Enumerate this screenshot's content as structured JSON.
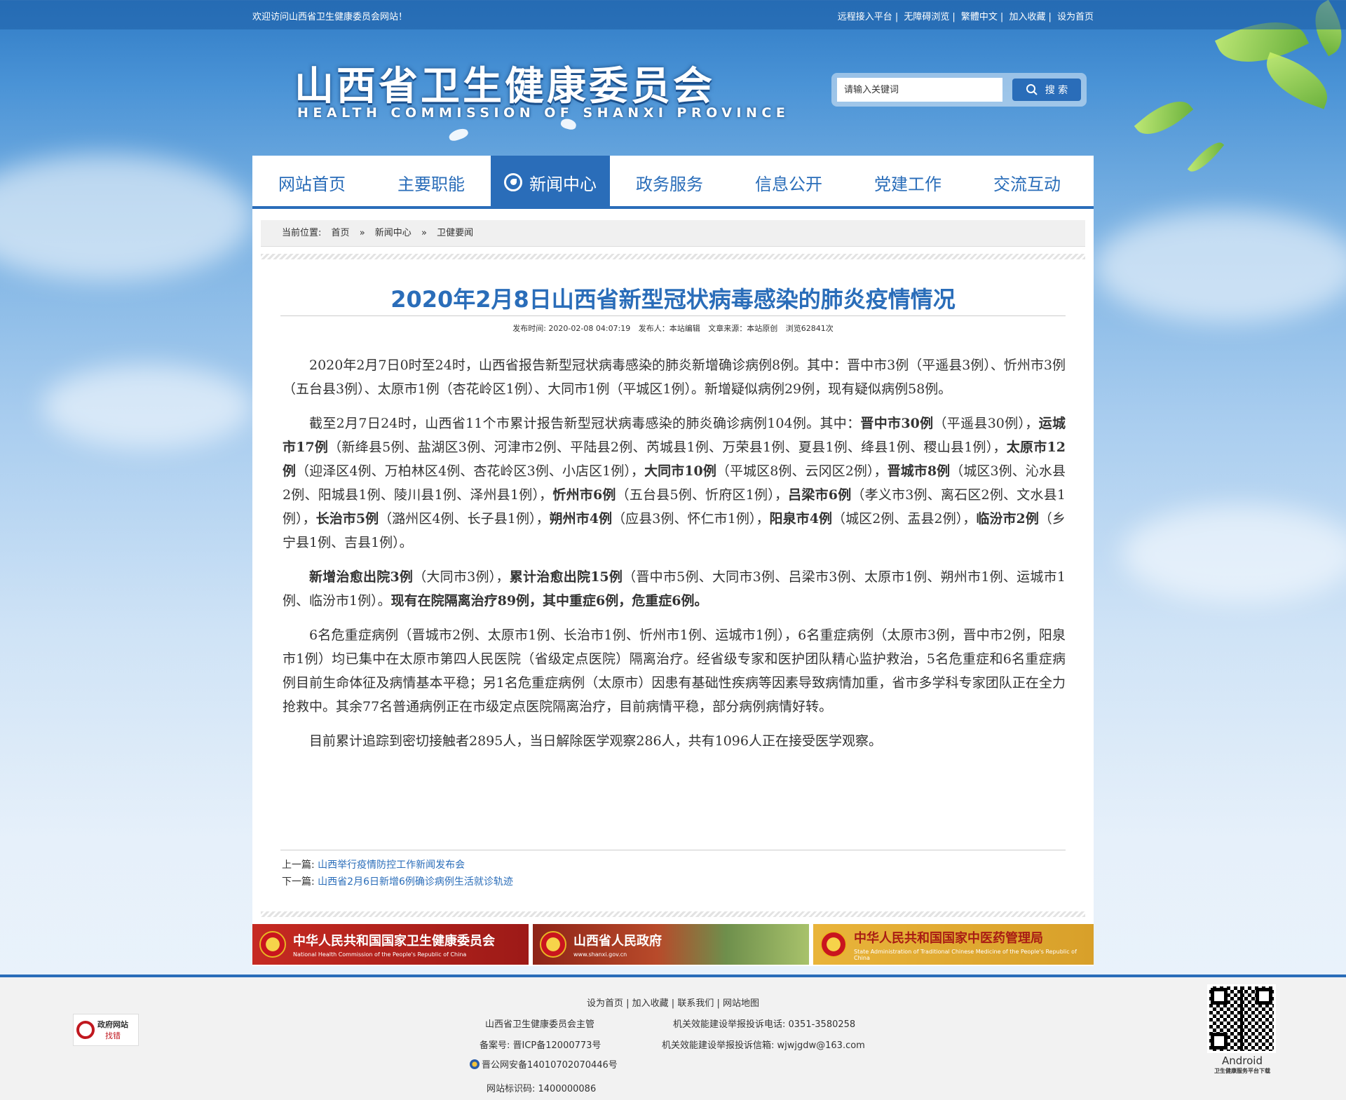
{
  "topbar": {
    "welcome": "欢迎访问山西省卫生健康委员会网站！",
    "links": [
      "远程接入平台",
      "无障碍浏览",
      "繁體中文",
      "加入收藏",
      "设为首页"
    ]
  },
  "logo": {
    "cn": "山西省卫生健康委员会",
    "en": "HEALTH COMMISSION OF SHANXI PROVINCE"
  },
  "search": {
    "placeholder": "请输入关键词",
    "button": "搜 索"
  },
  "nav": [
    "网站首页",
    "主要职能",
    "新闻中心",
    "政务服务",
    "信息公开",
    "党建工作",
    "交流互动"
  ],
  "breadcrumb": {
    "label": "当前位置:",
    "items": [
      "首页",
      "新闻中心",
      "卫健要闻"
    ],
    "sep": "»"
  },
  "article": {
    "title": "2020年2月8日山西省新型冠状病毒感染的肺炎疫情情况",
    "meta": {
      "publish_time": "发布时间:  2020-02-08 04:07:19",
      "publisher": "发布人：本站编辑",
      "source": "文章来源：本站原创",
      "views": "浏览62841次"
    }
  },
  "prevnext": {
    "prev_label": "上一篇:",
    "prev_title": "山西举行疫情防控工作新闻发布会",
    "next_label": "下一篇:",
    "next_title": "山西省2月6日新增6例确诊病例生活就诊轨迹"
  },
  "banners": [
    {
      "cn": "中华人民共和国国家卫生健康委员会",
      "en": "National Health Commission of the People's Republic of China",
      "color": "#b7211e"
    },
    {
      "cn": "山西省人民政府",
      "en": "www.shanxi.gov.cn",
      "color": "#9a2a1c"
    },
    {
      "cn": "中华人民共和国国家中医药管理局",
      "en": "State Administration of Traditional Chinese Medicine of the People's Republic of China",
      "color": "#c8941f"
    }
  ],
  "footer": {
    "links": [
      "设为首页",
      "加入收藏",
      "联系我们",
      "网站地图"
    ],
    "sponsor": "山西省卫生健康委员会主管",
    "phone": "机关效能建设举报投诉电话:  0351-3580258",
    "icp": "备案号:  晋ICP备12000773号",
    "email": "机关效能建设举报投诉信箱:  wjwjgdw@163.com",
    "police": "晋公网安备14010702070446号",
    "site_id": "网站标识码:  1400000086",
    "jiucuo_1": "政府网站",
    "jiucuo_2": "找错",
    "qr_label": "Android",
    "qr_sub": "卫生健康服务平台下载"
  },
  "colors": {
    "brand_blue": "#2a6db9",
    "nav_active_bg": "#2a6db9"
  }
}
